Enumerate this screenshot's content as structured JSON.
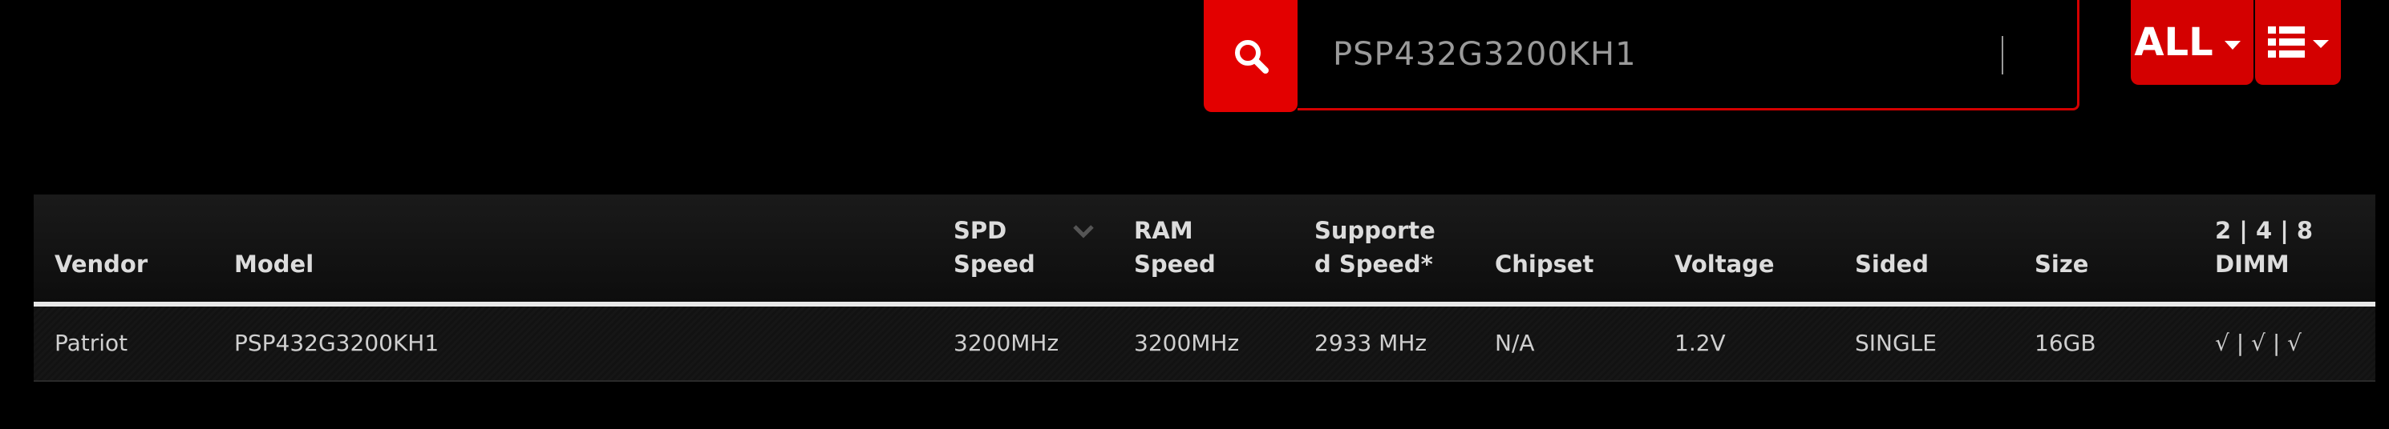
{
  "search": {
    "value": "PSP432G3200KH1",
    "icon": "search-icon"
  },
  "filter": {
    "label": "ALL",
    "icon": "caret-down-icon"
  },
  "view": {
    "icon": "list-view-icon"
  },
  "colors": {
    "accent": "#d40000",
    "background": "#000000",
    "header_bg": "#141414"
  },
  "table": {
    "headers": {
      "vendor": "Vendor",
      "model": "Model",
      "spd_speed": "SPD\nSpeed",
      "ram_speed": "RAM\nSpeed",
      "supported_speed": "Supporte\nd Speed*",
      "chipset": "Chipset",
      "voltage": "Voltage",
      "sided": "Sided",
      "size": "Size",
      "dimm": "2 | 4 | 8\nDIMM"
    },
    "rows": [
      {
        "vendor": "Patriot",
        "model": "PSP432G3200KH1",
        "spd_speed": "3200MHz",
        "ram_speed": "3200MHz",
        "supported_speed": "2933 MHz",
        "chipset": "N/A",
        "voltage": "1.2V",
        "sided": "SINGLE",
        "size": "16GB",
        "dimm": "√ | √ | √"
      }
    ]
  }
}
